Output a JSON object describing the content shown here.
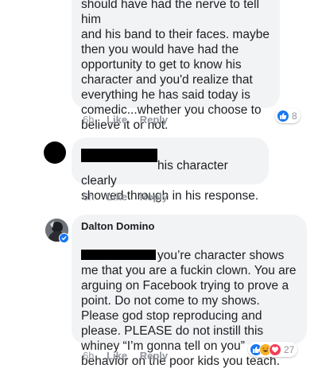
{
  "comments": [
    {
      "text": "should have had the nerve to tell him\nand his band to their faces. maybe\nthen you would have had the\nopportunity to get to know his\ncharacter and you'd realize that\neverything he has said today is\ncomedic...whether you choose to\nbelieve it or not.",
      "time": "6h",
      "like": "Like",
      "reply": "Reply",
      "reaction_count": "8",
      "reactions": [
        "like-icon"
      ]
    },
    {
      "text_after_redaction": "his character clearly",
      "text_rest": "showed through in his response.",
      "time": "6h",
      "like": "Like",
      "reply": "Reply"
    },
    {
      "author": "Dalton Domino",
      "text_after_redaction": "you’re character shows",
      "text_rest": "me that you are a fuckin clown. You are\narguing on Facebook trying to prove a\npoint. Do not come to my shows.\nPlease god stop reproducing and\nplease. PLEASE do not instill this\nwhiney “I’m gonna tell on you”\nbehavior on the poor kids you teach.",
      "time": "6h",
      "like": "Like",
      "reply": "Reply",
      "reaction_count": "27",
      "reactions": [
        "like-icon",
        "haha-icon",
        "love-icon"
      ]
    }
  ],
  "colors": {
    "bubble": "#f2f3f5",
    "meta": "#90949c",
    "like_blue": "#1877f2",
    "love_red": "#f33e58",
    "haha_yellow": "#f7b125"
  }
}
